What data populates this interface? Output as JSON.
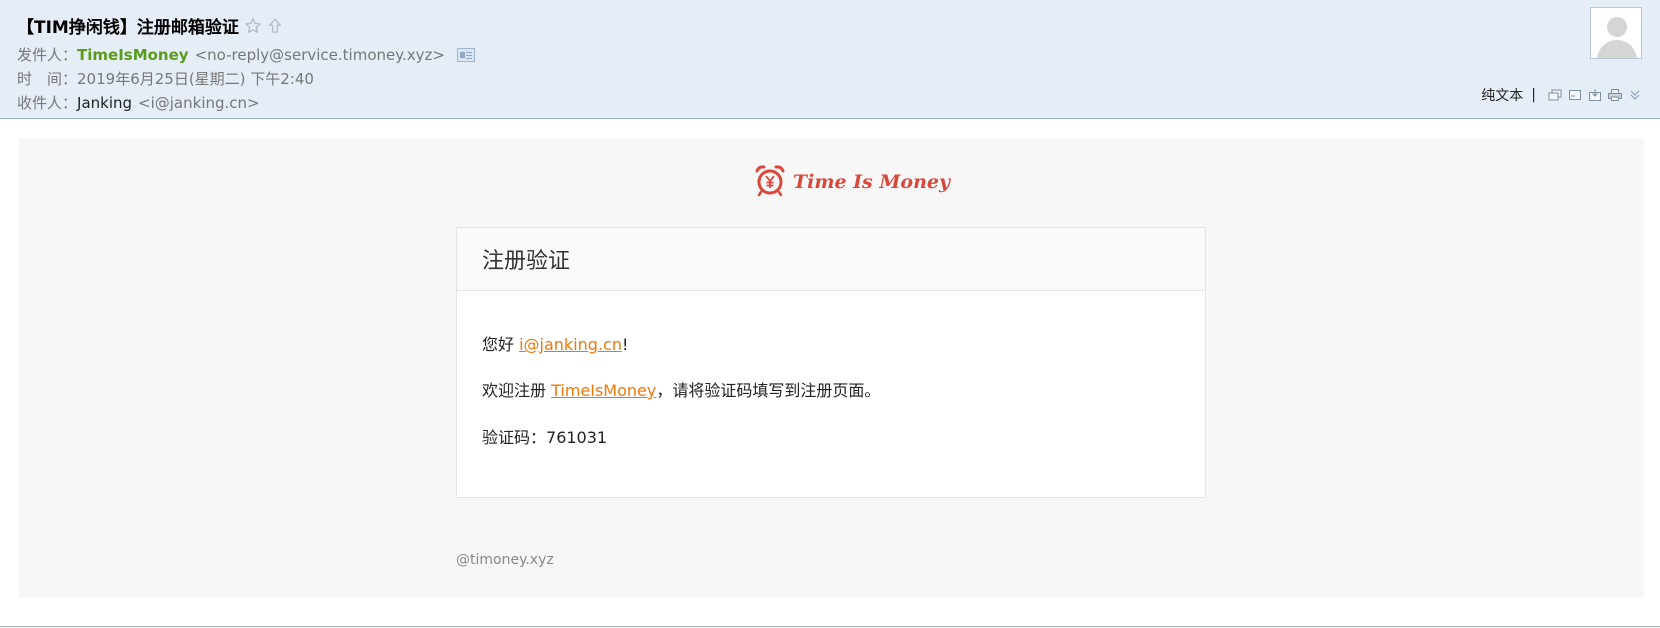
{
  "email": {
    "subject": "【TIM挣闲钱】注册邮箱验证",
    "from_label": "发件人：",
    "from_name": "TimeIsMoney",
    "from_addr": "<no-reply@service.timoney.xyz>",
    "time_label": "时　间：",
    "time_value": "2019年6月25日(星期二) 下午2:40",
    "to_label": "收件人：",
    "to_name": "Janking",
    "to_addr": "<i@janking.cn>"
  },
  "toolbar": {
    "plain_text": "纯文本",
    "separator": "|",
    "icons": [
      "new-window-icon",
      "copy-icon",
      "save-icon",
      "print-icon",
      "more-icon"
    ]
  },
  "body": {
    "logo_text": "Time Is Money",
    "card_title": "注册验证",
    "greeting_prefix": "您好 ",
    "greeting_link": "i@janking.cn",
    "greeting_suffix": "!",
    "welcome_prefix": "欢迎注册 ",
    "welcome_link": "TimeIsMoney",
    "welcome_suffix": "，请将验证码填写到注册页面。",
    "code_label": "验证码：",
    "code_value": "761031",
    "footer": "@timoney.xyz"
  },
  "colors": {
    "header_bg": "#e5edf6",
    "sender_green": "#5a9c1a",
    "link_orange": "#f0780a",
    "logo_red": "#d9473a"
  }
}
